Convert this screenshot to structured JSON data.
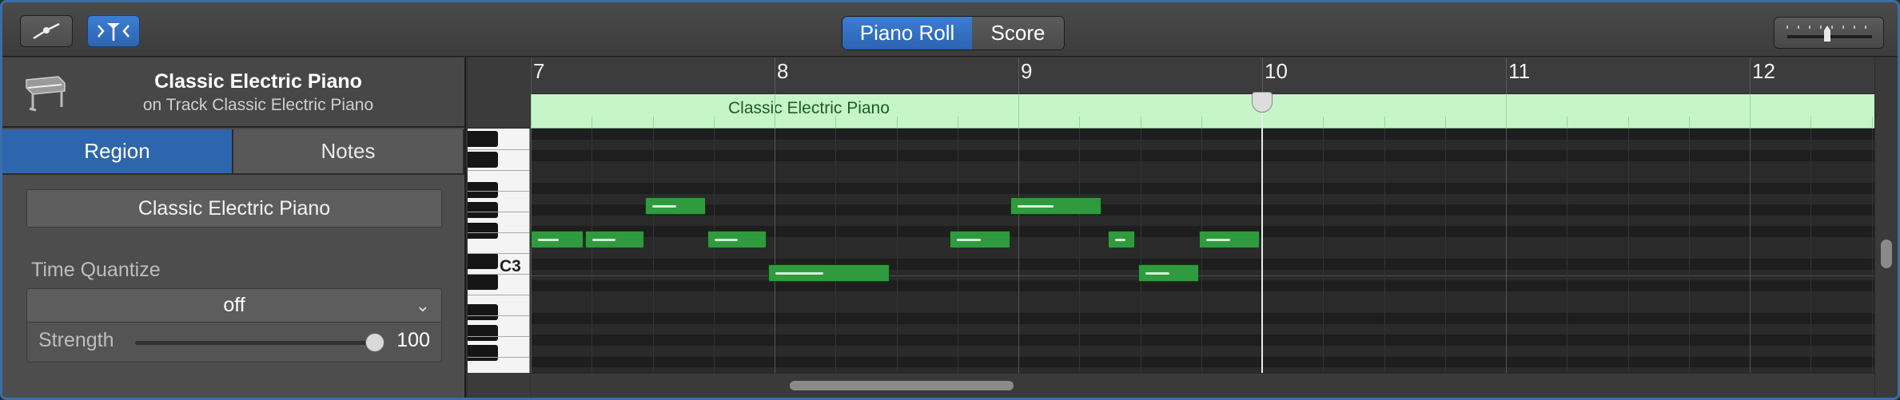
{
  "toolbar": {
    "automation_icon": "automation-curve-icon",
    "catch_icon": "playhead-catch-icon",
    "view_tabs": [
      {
        "label": "Piano Roll",
        "selected": true
      },
      {
        "label": "Score",
        "selected": false
      }
    ],
    "zoom_icon": "zoom-slider-icon"
  },
  "inspector": {
    "instrument_icon": "electric-piano-icon",
    "title": "Classic Electric Piano",
    "subtitle": "on Track Classic Electric Piano",
    "tabs": [
      {
        "label": "Region",
        "selected": true
      },
      {
        "label": "Notes",
        "selected": false
      }
    ],
    "region_name": "Classic Electric Piano",
    "time_quantize_label": "Time Quantize",
    "time_quantize_value": "off",
    "strength_label": "Strength",
    "strength_value": "100"
  },
  "editor": {
    "bar_numbers": [
      "7",
      "8",
      "9",
      "10",
      "11",
      "12"
    ],
    "region_label": "Classic Electric Piano",
    "key_label": "C3",
    "colors": {
      "region_fill": "#c5f5c9",
      "note_fill": "#2f9a3e",
      "accent": "#2e66ae"
    }
  }
}
